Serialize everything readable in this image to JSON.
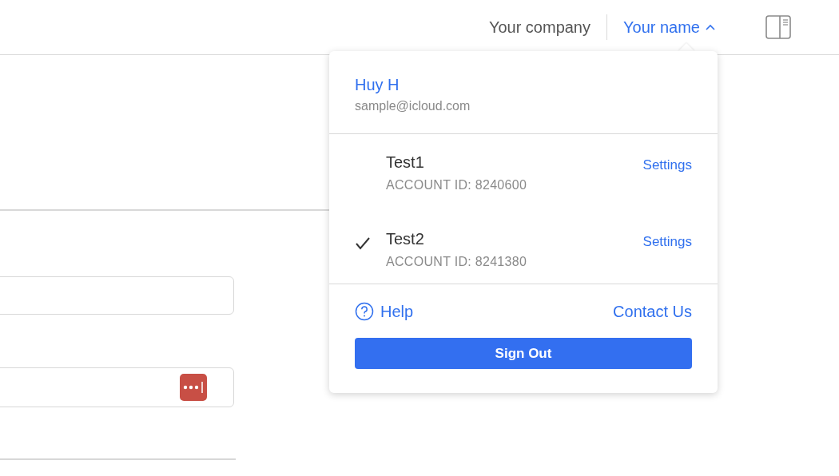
{
  "header": {
    "company": "Your company",
    "user_menu": {
      "label": "Your name",
      "expanded": true
    }
  },
  "menu": {
    "user": {
      "name": "Huy H",
      "email": "sample@icloud.com"
    },
    "accounts": [
      {
        "name": "Test1",
        "account_id": "ACCOUNT ID: 8240600",
        "settings": "Settings",
        "selected": false
      },
      {
        "name": "Test2",
        "account_id": "ACCOUNT ID: 8241380",
        "settings": "Settings",
        "selected": true
      }
    ],
    "help": "Help",
    "contact": "Contact Us",
    "sign_out": "Sign Out"
  }
}
